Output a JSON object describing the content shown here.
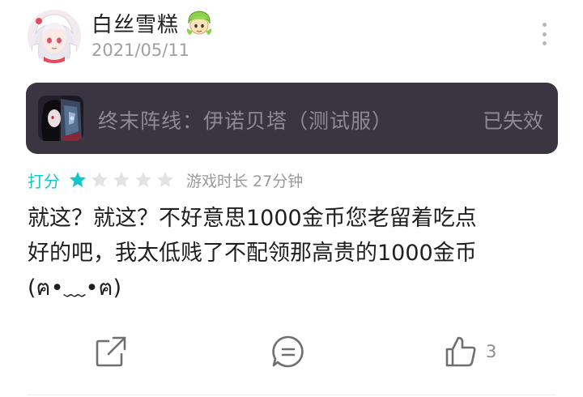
{
  "user": {
    "name": "白丝雪糕",
    "date": "2021/05/11",
    "avatar_icon": "anime-girl-avatar",
    "badge_icon": "green-hair-character-badge"
  },
  "game_card": {
    "title": "终末阵线：伊诺贝塔（测试服）",
    "status": "已失效",
    "icon": "game-icon-dark-character",
    "background_color": "#3a3541"
  },
  "rating": {
    "label": "打分",
    "stars": 1,
    "max_stars": 5,
    "playtime": "游戏时长 27分钟",
    "accent_color": "#15c5ce"
  },
  "review": {
    "line1": "就这？就这？不好意思1000金币您老留着吃点",
    "line2": "好的吧，我太低贱了不配领那高贵的1000金币",
    "line3": "(ฅ•﹏•ฅ)"
  },
  "actions": {
    "share_icon": "share-icon",
    "comment_icon": "comment-icon",
    "like_icon": "thumbs-up-icon",
    "like_count": "3"
  }
}
